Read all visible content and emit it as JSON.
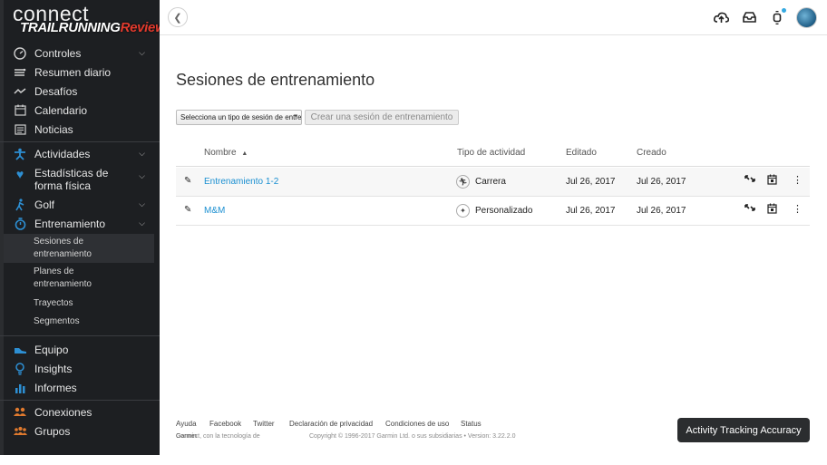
{
  "brand": {
    "connect": "connect",
    "overlay_main": "TRAILRUNNING",
    "overlay_accent": "Review"
  },
  "sidebar": {
    "items": [
      {
        "label": "Controles",
        "icon": "gauge-icon"
      },
      {
        "label": "Resumen diario",
        "icon": "daily-summary-icon"
      },
      {
        "label": "Desafíos",
        "icon": "challenges-icon"
      },
      {
        "label": "Calendario",
        "icon": "calendar-icon"
      },
      {
        "label": "Noticias",
        "icon": "news-icon"
      },
      {
        "label": "Actividades",
        "icon": "activities-icon"
      },
      {
        "label": "Estadísticas de forma física",
        "icon": "heart-icon"
      },
      {
        "label": "Golf",
        "icon": "golf-icon"
      },
      {
        "label": "Entrenamiento",
        "icon": "stopwatch-icon"
      },
      {
        "label": "Equipo",
        "icon": "shoe-icon"
      },
      {
        "label": "Insights",
        "icon": "lightbulb-icon"
      },
      {
        "label": "Informes",
        "icon": "bar-chart-icon"
      },
      {
        "label": "Conexiones",
        "icon": "connections-icon"
      },
      {
        "label": "Grupos",
        "icon": "groups-icon"
      }
    ],
    "sub_items": [
      {
        "label": "Sesiones de entrenamiento"
      },
      {
        "label": "Planes de entrenamiento"
      },
      {
        "label": "Trayectos"
      },
      {
        "label": "Segmentos"
      }
    ]
  },
  "main": {
    "title": "Sesiones de entrenamiento",
    "type_select": "Selecciona un tipo de sesión de entrenamiento",
    "create_button": "Crear una sesión de entrenamiento",
    "table": {
      "headers": {
        "name": "Nombre",
        "sort_indicator": "▲",
        "activity_type": "Tipo de actividad",
        "edited": "Editado",
        "created": "Creado"
      },
      "rows": [
        {
          "name": "Entrenamiento 1-2",
          "activity_type": "Carrera",
          "edited": "Jul 26, 2017",
          "created": "Jul 26, 2017"
        },
        {
          "name": "M&M",
          "activity_type": "Personalizado",
          "edited": "Jul 26, 2017",
          "created": "Jul 26, 2017"
        }
      ]
    }
  },
  "footer": {
    "links": [
      "Ayuda",
      "Facebook",
      "Twitter",
      "Declaración de privacidad",
      "Condiciones de uso",
      "Status"
    ],
    "powered_by": "Connect, con la tecnología de",
    "powered_brand": "Garmin",
    "copyright": "Copyright © 1996-2017 Garmin Ltd. o sus subsidiarias • Version: 3.22.2.0"
  },
  "accuracy_button": "Activity Tracking Accuracy",
  "colors": {
    "accent": "#1a8fd1",
    "sidebar_bg": "#1d1f22",
    "notification": "#35a9e1"
  }
}
